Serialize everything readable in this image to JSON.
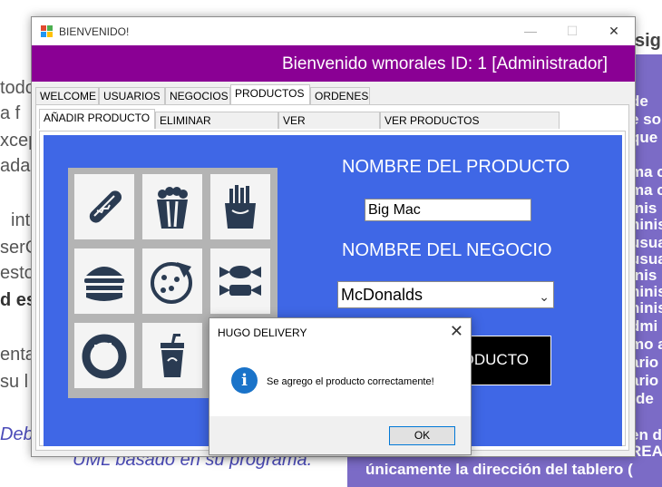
{
  "window": {
    "title": "BIENVENIDO!",
    "minimize": "—",
    "maximize": "☐",
    "close": "✕"
  },
  "header": {
    "welcome": "Bienvenido wmorales  ID: 1  [Administrador]"
  },
  "main_tabs": [
    "WELCOME",
    "USUARIOS",
    "NEGOCIOS",
    "PRODUCTOS",
    "ORDENES"
  ],
  "sub_tabs": [
    "AÑADIR PRODUCTO",
    "ELIMINAR PRODUCTO",
    "VER PRODUCTOS",
    "VER PRODUCTOS RESTAURANTE"
  ],
  "form": {
    "product_name_label": "NOMBRE DEL PRODUCTO",
    "product_name_value": "Big Mac",
    "business_label": "NOMBRE DEL NEGOCIO",
    "business_value": "McDonalds",
    "add_button_label": "ODUCTO"
  },
  "food_icons": [
    "hotdog-icon",
    "popcorn-icon",
    "fries-icon",
    "burger-icon",
    "pizza-icon",
    "candy-icon",
    "donut-icon",
    "soda-icon"
  ],
  "dialog": {
    "title": "HUGO DELIVERY",
    "message": "Se agrego el producto correctamente!",
    "ok_label": "OK",
    "close": "✕"
  },
  "background": {
    "left_lines": [
      "todo",
      "a  f",
      "xcep",
      "adas",
      "int",
      "serC",
      "esto",
      "d es",
      "enta",
      "su l"
    ],
    "blue_line_1": "Debe",
    "blue_line_2": "UML basado en su programa.",
    "top_right": "sig",
    "panel_lines": [
      "de",
      "e so",
      "que",
      "ma c",
      "ma c",
      "inis",
      "ninis",
      "usua",
      "usua",
      "inis",
      "ninis",
      "ninis",
      "dmi",
      "mo a",
      "ario",
      "ario",
      "de",
      "en d",
      "REA",
      "únicamente la dirección del tablero ("
    ]
  },
  "colors": {
    "header": "#8a0094",
    "panel": "#3f67e6",
    "info": "#1a73c9"
  }
}
